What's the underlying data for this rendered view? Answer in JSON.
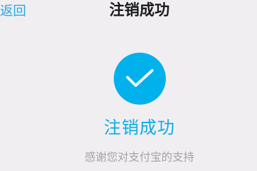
{
  "nav": {
    "back_label": "返回",
    "title": "注销成功"
  },
  "result": {
    "icon": "checkmark-icon",
    "title": "注销成功",
    "subtitle": "感谢您对支付宝的支持"
  },
  "colors": {
    "background": "#f1eef2",
    "accent": "#00b1eb",
    "back_link": "#22a7e5",
    "title_text": "#1b1b1b",
    "subtitle_text": "#a3a3a8"
  }
}
